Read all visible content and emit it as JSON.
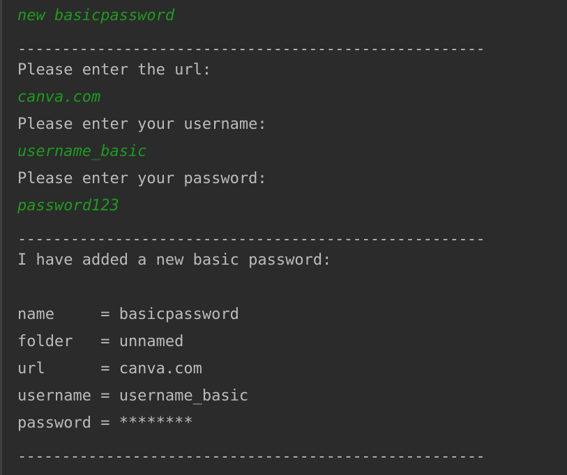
{
  "console": {
    "command_input": "new basicpassword",
    "separator": "-----------------------------------------------------",
    "prompt_url": "Please enter the url:",
    "input_url": "canva.com",
    "prompt_username": "Please enter your username:",
    "input_username": "username_basic",
    "prompt_password": "Please enter your password:",
    "input_password": "password123",
    "result_message": "I have added a new basic password:",
    "fields": [
      "name     = basicpassword",
      "folder   = unnamed",
      "url      = canva.com",
      "username = username_basic",
      "password = ********"
    ]
  },
  "colors": {
    "background": "#2b2b2b",
    "output_text": "#bbbbbb",
    "user_input_text": "#1f9a1f"
  }
}
